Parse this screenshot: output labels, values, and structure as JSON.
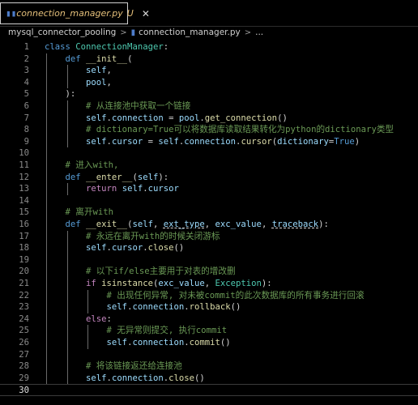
{
  "tab": {
    "filename": "connection_manager.py",
    "status": "U",
    "close_glyph": "✕"
  },
  "breadcrumb": {
    "folder": "mysql_connector_pooling",
    "file": "connection_manager.py",
    "more": "..."
  },
  "editor": {
    "current_line": 30,
    "lines": [
      {
        "n": "1",
        "t": [
          [
            "kw",
            "class "
          ],
          [
            "cls",
            "ConnectionManager"
          ],
          [
            "pu",
            ":"
          ]
        ]
      },
      {
        "n": "2",
        "t": [
          [
            "pu",
            "    "
          ],
          [
            "kw",
            "def "
          ],
          [
            "fn",
            "__init__"
          ],
          [
            "pu",
            "("
          ]
        ]
      },
      {
        "n": "3",
        "t": [
          [
            "pu",
            "        "
          ],
          [
            "sf",
            "self"
          ],
          [
            "pu",
            ","
          ]
        ]
      },
      {
        "n": "4",
        "t": [
          [
            "pu",
            "        "
          ],
          [
            "var",
            "pool"
          ],
          [
            "pu",
            ","
          ]
        ]
      },
      {
        "n": "5",
        "t": [
          [
            "pu",
            "    ):"
          ]
        ]
      },
      {
        "n": "6",
        "t": [
          [
            "pu",
            "        "
          ],
          [
            "cm",
            "# 从连接池中获取一个链接"
          ]
        ]
      },
      {
        "n": "7",
        "t": [
          [
            "pu",
            "        "
          ],
          [
            "sf",
            "self"
          ],
          [
            "pu",
            "."
          ],
          [
            "var",
            "connection"
          ],
          [
            "pu",
            " = "
          ],
          [
            "var",
            "pool"
          ],
          [
            "pu",
            "."
          ],
          [
            "fn",
            "get_connection"
          ],
          [
            "pu",
            "()"
          ]
        ]
      },
      {
        "n": "8",
        "t": [
          [
            "pu",
            "        "
          ],
          [
            "cm",
            "# dictionary=True可以将数据库读取结果转化为python的dictionary类型"
          ]
        ]
      },
      {
        "n": "9",
        "t": [
          [
            "pu",
            "        "
          ],
          [
            "sf",
            "self"
          ],
          [
            "pu",
            "."
          ],
          [
            "var",
            "cursor"
          ],
          [
            "pu",
            " = "
          ],
          [
            "sf",
            "self"
          ],
          [
            "pu",
            "."
          ],
          [
            "var",
            "connection"
          ],
          [
            "pu",
            "."
          ],
          [
            "fn",
            "cursor"
          ],
          [
            "pu",
            "("
          ],
          [
            "var",
            "dictionary"
          ],
          [
            "pu",
            "="
          ],
          [
            "kw",
            "True"
          ],
          [
            "pu",
            ")"
          ]
        ]
      },
      {
        "n": "10",
        "t": []
      },
      {
        "n": "11",
        "t": [
          [
            "pu",
            "    "
          ],
          [
            "cm",
            "# 进入with,"
          ]
        ]
      },
      {
        "n": "12",
        "t": [
          [
            "pu",
            "    "
          ],
          [
            "kw",
            "def "
          ],
          [
            "fn",
            "__enter__"
          ],
          [
            "pu",
            "("
          ],
          [
            "sf",
            "self"
          ],
          [
            "pu",
            "):"
          ]
        ]
      },
      {
        "n": "13",
        "t": [
          [
            "pu",
            "        "
          ],
          [
            "kw2",
            "return "
          ],
          [
            "sf",
            "self"
          ],
          [
            "pu",
            "."
          ],
          [
            "var",
            "cursor"
          ]
        ]
      },
      {
        "n": "14",
        "t": []
      },
      {
        "n": "15",
        "t": [
          [
            "pu",
            "    "
          ],
          [
            "cm",
            "# 离开with"
          ]
        ]
      },
      {
        "n": "16",
        "t": [
          [
            "pu",
            "    "
          ],
          [
            "kw",
            "def "
          ],
          [
            "fn",
            "__exit__"
          ],
          [
            "pu",
            "("
          ],
          [
            "sf",
            "self"
          ],
          [
            "pu",
            ", "
          ],
          [
            "var ul",
            "ext_type"
          ],
          [
            "pu",
            ", "
          ],
          [
            "var",
            "exc_value"
          ],
          [
            "pu",
            ", "
          ],
          [
            "var ul",
            "traceback"
          ],
          [
            "pu",
            "):"
          ]
        ]
      },
      {
        "n": "17",
        "t": [
          [
            "pu",
            "        "
          ],
          [
            "cm",
            "# 永远在离开with的时候关闭游标"
          ]
        ]
      },
      {
        "n": "18",
        "t": [
          [
            "pu",
            "        "
          ],
          [
            "sf",
            "self"
          ],
          [
            "pu",
            "."
          ],
          [
            "var",
            "cursor"
          ],
          [
            "pu",
            "."
          ],
          [
            "fn",
            "close"
          ],
          [
            "pu",
            "()"
          ]
        ]
      },
      {
        "n": "19",
        "t": []
      },
      {
        "n": "20",
        "t": [
          [
            "pu",
            "        "
          ],
          [
            "cm",
            "# 以下if/else主要用于对表的增改删"
          ]
        ]
      },
      {
        "n": "21",
        "t": [
          [
            "pu",
            "        "
          ],
          [
            "kw2",
            "if "
          ],
          [
            "fn",
            "isinstance"
          ],
          [
            "pu",
            "("
          ],
          [
            "var",
            "exc_value"
          ],
          [
            "pu",
            ", "
          ],
          [
            "cls",
            "Exception"
          ],
          [
            "pu",
            "):"
          ]
        ]
      },
      {
        "n": "22",
        "t": [
          [
            "pu",
            "            "
          ],
          [
            "cm",
            "# 出现任何异常, 对未被commit的此次数据库的所有事务进行回滚"
          ]
        ]
      },
      {
        "n": "23",
        "t": [
          [
            "pu",
            "            "
          ],
          [
            "sf",
            "self"
          ],
          [
            "pu",
            "."
          ],
          [
            "var",
            "connection"
          ],
          [
            "pu",
            "."
          ],
          [
            "fn",
            "rollback"
          ],
          [
            "pu",
            "()"
          ]
        ]
      },
      {
        "n": "24",
        "t": [
          [
            "pu",
            "        "
          ],
          [
            "kw2",
            "else"
          ],
          [
            "pu",
            ":"
          ]
        ]
      },
      {
        "n": "25",
        "t": [
          [
            "pu",
            "            "
          ],
          [
            "cm",
            "# 无异常则提交, 执行commit"
          ]
        ]
      },
      {
        "n": "26",
        "t": [
          [
            "pu",
            "            "
          ],
          [
            "sf",
            "self"
          ],
          [
            "pu",
            "."
          ],
          [
            "var",
            "connection"
          ],
          [
            "pu",
            "."
          ],
          [
            "fn",
            "commit"
          ],
          [
            "pu",
            "()"
          ]
        ]
      },
      {
        "n": "27",
        "t": []
      },
      {
        "n": "28",
        "t": [
          [
            "pu",
            "        "
          ],
          [
            "cm",
            "# 将该链接返还给连接池"
          ]
        ]
      },
      {
        "n": "29",
        "t": [
          [
            "pu",
            "        "
          ],
          [
            "sf",
            "self"
          ],
          [
            "pu",
            "."
          ],
          [
            "var",
            "connection"
          ],
          [
            "pu",
            "."
          ],
          [
            "fn",
            "close"
          ],
          [
            "pu",
            "()"
          ]
        ]
      },
      {
        "n": "30",
        "t": []
      }
    ]
  },
  "colors": {
    "keyword": "#569cd6",
    "control": "#c586c0",
    "class": "#4ec9b0",
    "function": "#dcdcaa",
    "variable": "#9cdcfe",
    "comment": "#6a9955",
    "tab_text": "#e5c07b"
  },
  "icons": {
    "tab_file_icon": "python-file-icon",
    "breadcrumb_file_icon": "python-file-icon",
    "close_icon": "close-icon",
    "chevron": "chevron-right-icon"
  }
}
